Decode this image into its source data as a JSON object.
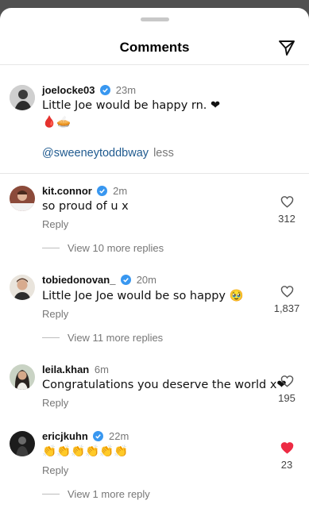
{
  "header": {
    "title": "Comments"
  },
  "pinned": {
    "username": "joelocke03",
    "time": "23m",
    "line1": "Little Joe would be happy rn. ❤",
    "line2": "🩸🥧",
    "mention": "@sweeneytoddbway",
    "less": "less"
  },
  "comments": [
    {
      "username": "kit.connor",
      "time": "2m",
      "text": "so proud of u x",
      "reply": "Reply",
      "likes": "312",
      "view_more": "View 10 more replies",
      "liked": false
    },
    {
      "username": "tobiedonovan_",
      "time": "20m",
      "text": "Little Joe Joe would be so happy 🥹",
      "reply": "Reply",
      "likes": "1,837",
      "view_more": "View 11 more replies",
      "liked": false
    },
    {
      "username": "leila.khan",
      "time": "6m",
      "text": "Congratulations you deserve the world x❤",
      "reply": "Reply",
      "likes": "195",
      "view_more": "",
      "liked": false
    },
    {
      "username": "ericjkuhn",
      "time": "22m",
      "text": "👏👏👏👏👏👏",
      "reply": "Reply",
      "likes": "23",
      "view_more": "View 1 more reply",
      "liked": true
    }
  ],
  "colors": {
    "verified": "#3897f0",
    "liked_heart": "#ed2b44",
    "mention": "#1f5a8f"
  }
}
